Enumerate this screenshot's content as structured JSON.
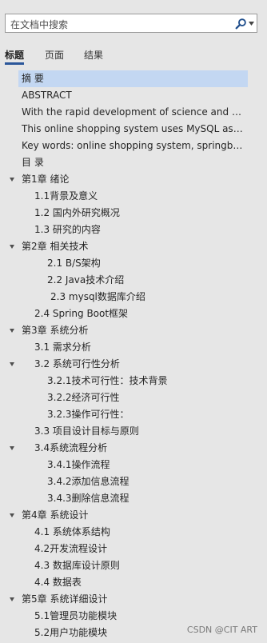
{
  "search": {
    "placeholder": "在文档中搜索"
  },
  "tabs": [
    {
      "label": "标题",
      "active": true
    },
    {
      "label": "页面",
      "active": false
    },
    {
      "label": "结果",
      "active": false
    }
  ],
  "outline": [
    {
      "text": "摘  要",
      "level": 1,
      "selected": true
    },
    {
      "text": "ABSTRACT",
      "level": 1
    },
    {
      "text": "With the rapid development of science and technology",
      "level": 1
    },
    {
      "text": "This online shopping system uses MySQL as the database",
      "level": 1
    },
    {
      "text": "Key words: online shopping system, springboot framework",
      "level": 1
    },
    {
      "text": "目  录",
      "level": 1
    },
    {
      "text": "第1章  绪论",
      "level": 1,
      "toggle": true
    },
    {
      "text": "1.1背景及意义",
      "level": 2
    },
    {
      "text": "1.2 国内外研究概况",
      "level": 2
    },
    {
      "text": "1.3 研究的内容",
      "level": 2
    },
    {
      "text": "第2章  相关技术",
      "level": 1,
      "toggle": true
    },
    {
      "text": "2.1  B/S架构",
      "level": 3
    },
    {
      "text": "2.2  Java技术介绍",
      "level": 3
    },
    {
      "text": "2.3 mysql数据库介绍",
      "level": 3,
      "indent_extra": true
    },
    {
      "text": "2.4 Spring Boot框架",
      "level": 2
    },
    {
      "text": "第3章  系统分析",
      "level": 1,
      "toggle": true
    },
    {
      "text": "3.1 需求分析",
      "level": 2
    },
    {
      "text": "3.2 系统可行性分析",
      "level": 2,
      "toggle": true
    },
    {
      "text": "3.2.1技术可行性：技术背景",
      "level": 3
    },
    {
      "text": "3.2.2经济可行性",
      "level": 3
    },
    {
      "text": "3.2.3操作可行性：",
      "level": 3
    },
    {
      "text": "3.3 项目设计目标与原则",
      "level": 2
    },
    {
      "text": "3.4系统流程分析",
      "level": 2,
      "toggle": true
    },
    {
      "text": "3.4.1操作流程",
      "level": 3
    },
    {
      "text": "3.4.2添加信息流程",
      "level": 3
    },
    {
      "text": "3.4.3删除信息流程",
      "level": 3
    },
    {
      "text": "第4章  系统设计",
      "level": 1,
      "toggle": true
    },
    {
      "text": "4.1 系统体系结构",
      "level": 2
    },
    {
      "text": "4.2开发流程设计",
      "level": 2
    },
    {
      "text": "4.3 数据库设计原则",
      "level": 2
    },
    {
      "text": "4.4 数据表",
      "level": 2
    },
    {
      "text": "第5章  系统详细设计",
      "level": 1,
      "toggle": true
    },
    {
      "text": "5.1管理员功能模块",
      "level": 2
    },
    {
      "text": "5.2用户功能模块",
      "level": 2
    }
  ],
  "watermark": "CSDN @CIT ART",
  "colors": {
    "background": "#e6e6e6",
    "selected": "#c3d7f2",
    "tab_underline": "#2b579a"
  }
}
